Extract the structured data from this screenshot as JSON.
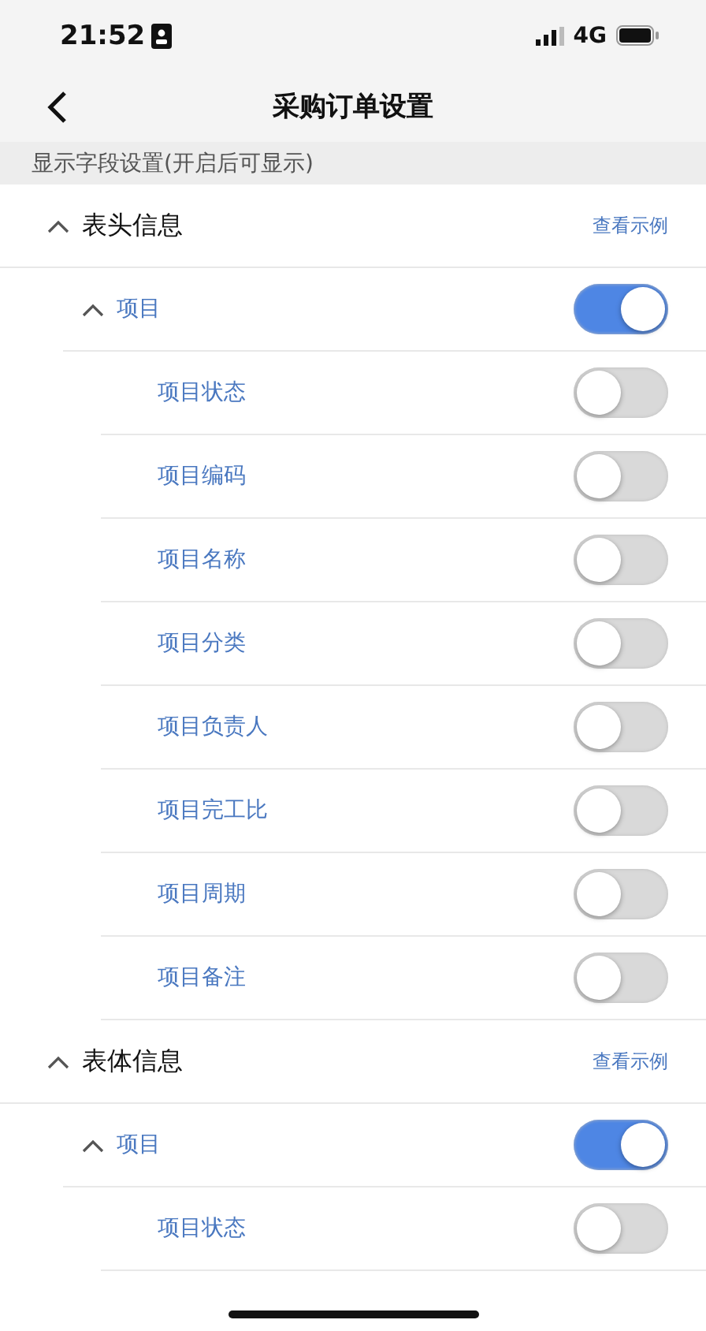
{
  "status_bar": {
    "time": "21:52",
    "network": "4G"
  },
  "nav": {
    "title": "采购订单设置"
  },
  "subheader": "显示字段设置(开启后可显示)",
  "sections": [
    {
      "title": "表头信息",
      "expanded": true,
      "link": "查看示例",
      "children": [
        {
          "label": "项目",
          "expanded": true,
          "on": true,
          "children": [
            {
              "label": "项目状态",
              "on": false
            },
            {
              "label": "项目编码",
              "on": false
            },
            {
              "label": "项目名称",
              "on": false
            },
            {
              "label": "项目分类",
              "on": false
            },
            {
              "label": "项目负责人",
              "on": false
            },
            {
              "label": "项目完工比",
              "on": false
            },
            {
              "label": "项目周期",
              "on": false
            },
            {
              "label": "项目备注",
              "on": false
            }
          ]
        }
      ]
    },
    {
      "title": "表体信息",
      "expanded": true,
      "link": "查看示例",
      "children": [
        {
          "label": "项目",
          "expanded": true,
          "on": true,
          "children": [
            {
              "label": "项目状态",
              "on": false
            }
          ]
        }
      ]
    }
  ]
}
